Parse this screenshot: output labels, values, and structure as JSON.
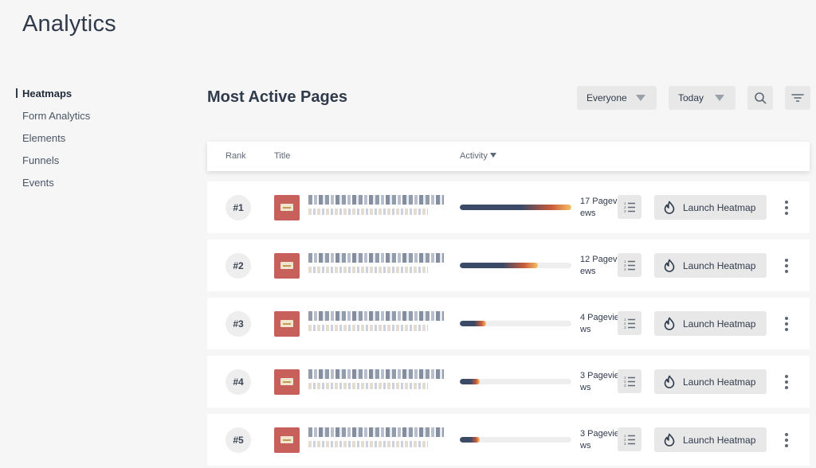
{
  "app": {
    "title": "Analytics"
  },
  "sidebar": {
    "items": [
      {
        "label": "Heatmaps",
        "active": true
      },
      {
        "label": "Form Analytics",
        "active": false
      },
      {
        "label": "Elements",
        "active": false
      },
      {
        "label": "Funnels",
        "active": false
      },
      {
        "label": "Events",
        "active": false
      }
    ]
  },
  "main": {
    "title": "Most Active Pages",
    "filters": {
      "audience": "Everyone",
      "period": "Today"
    }
  },
  "table": {
    "columns": {
      "rank": "Rank",
      "title": "Title",
      "activity": "Activity"
    },
    "launch_label": "Launch Heatmap",
    "rows": [
      {
        "rank": "#1",
        "pageviews": "17 Pageviews",
        "activity": 1.0
      },
      {
        "rank": "#2",
        "pageviews": "12 Pageviews",
        "activity": 0.7
      },
      {
        "rank": "#3",
        "pageviews": "4 Pageviews",
        "activity": 0.235
      },
      {
        "rank": "#4",
        "pageviews": "3 Pageviews",
        "activity": 0.176
      },
      {
        "rank": "#5",
        "pageviews": "3 Pageviews",
        "activity": 0.176
      }
    ]
  },
  "colors": {
    "background": "#f6f6f6",
    "text": "#2f3a4b",
    "thumb": "#c75f5b",
    "bar_start": "#3b4a66",
    "bar_mid": "#c85a3a",
    "bar_end": "#f6c064"
  },
  "icons": [
    "search-icon",
    "filter-icon",
    "caret-down-icon",
    "list-icon",
    "flame-icon",
    "more-vertical-icon"
  ]
}
